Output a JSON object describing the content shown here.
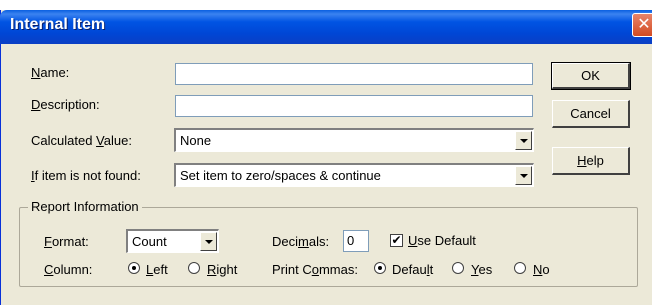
{
  "window": {
    "title": "Internal Item",
    "close_glyph": "✕"
  },
  "fields": {
    "name_label_pre": "",
    "name_label_u": "N",
    "name_label_post": "ame:",
    "name_value": "",
    "description_label_u": "D",
    "description_label_post": "escription:",
    "description_value": "",
    "calculated_label_pre": "Calculated ",
    "calculated_label_u": "V",
    "calculated_label_post": "alue:",
    "calculated_value": "None",
    "notfound_label_u": "I",
    "notfound_label_post": "f item is not found:",
    "notfound_value": "Set item to zero/spaces & continue"
  },
  "buttons": {
    "ok": "OK",
    "cancel": "Cancel",
    "help_u": "H",
    "help_post": "elp"
  },
  "report": {
    "group_label": "Report Information",
    "format_label_u": "F",
    "format_label_post": "ormat:",
    "format_value": "Count",
    "decimals_label_pre": "Deci",
    "decimals_label_u": "m",
    "decimals_label_post": "als:",
    "decimals_value": "0",
    "use_default_u": "U",
    "use_default_post": "se Default",
    "use_default_checked": true,
    "checkmark": "✔",
    "column_label_u": "C",
    "column_label_post": "olumn:",
    "column_left_u": "L",
    "column_left_post": "eft",
    "column_right_u": "R",
    "column_right_post": "ight",
    "column_selected": "left",
    "print_commas_label_pre": "Print C",
    "print_commas_label_u": "o",
    "print_commas_label_post": "mmas:",
    "commas_default_pre": "Defau",
    "commas_default_u": "l",
    "commas_default_post": "t",
    "commas_yes_u": "Y",
    "commas_yes_post": "es",
    "commas_no_u": "N",
    "commas_no_post": "o",
    "commas_selected": "default"
  }
}
